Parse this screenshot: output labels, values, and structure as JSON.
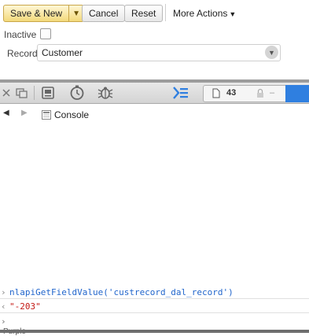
{
  "form": {
    "save_new_label": "Save & New",
    "cancel_label": "Cancel",
    "reset_label": "Reset",
    "more_actions_label": "More Actions",
    "inactive_label": "Inactive",
    "record_label": "Record",
    "record_value": "Customer",
    "inactive_checked": false
  },
  "devtools": {
    "resource_count": "43",
    "lock_value": "–",
    "accent": "#2f7fe0"
  },
  "console": {
    "tab_label": "Console",
    "command": "nlapiGetFieldValue('custrecord_dal_record')",
    "result": "\"-203\"",
    "input_value": "",
    "truncated_text": "Purple"
  },
  "icons": {
    "close": "close-icon",
    "undock": "undock-icon",
    "elements": "elements-icon",
    "timeline": "timeline-icon",
    "debugger": "bug-icon",
    "console_toggle": "console-toggle-icon",
    "back": "back-arrow-icon",
    "forward": "forward-arrow-icon"
  }
}
